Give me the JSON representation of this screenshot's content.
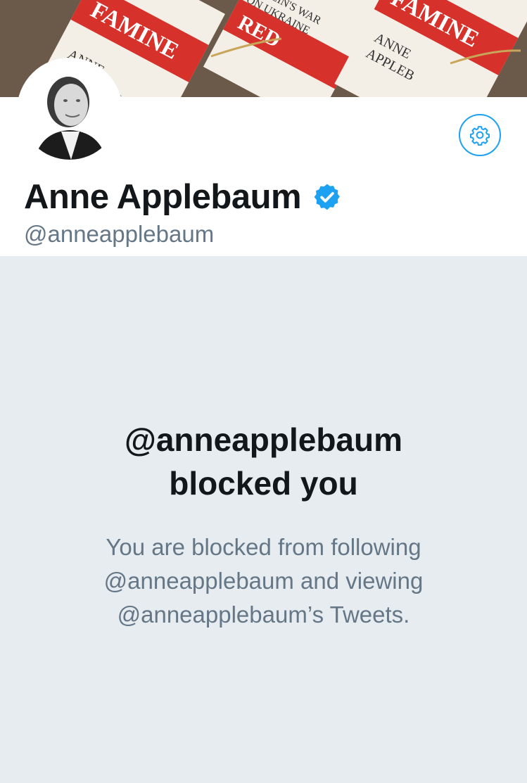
{
  "profile": {
    "display_name": "Anne Applebaum",
    "handle": "@anneapplebaum",
    "verified": true,
    "verified_icon": "verified-badge-icon",
    "settings_icon": "gear-icon",
    "banner_text": {
      "book_title": "RED FAMINE",
      "author": "ANNE APPLEBAUM",
      "subtitle": "STALIN'S WAR ON UKRAINE"
    }
  },
  "blocked_notice": {
    "title_line1": "@anneapplebaum",
    "title_line2": "blocked you",
    "message_line1": "You are blocked from following",
    "message_line2": "@anneapplebaum and viewing",
    "message_line3": "@anneapplebaum’s Tweets."
  },
  "colors": {
    "accent": "#1da1f2",
    "text_primary": "#14171a",
    "text_secondary": "#657786",
    "background": "#e6ecf0",
    "banner_red": "#d6322b"
  }
}
